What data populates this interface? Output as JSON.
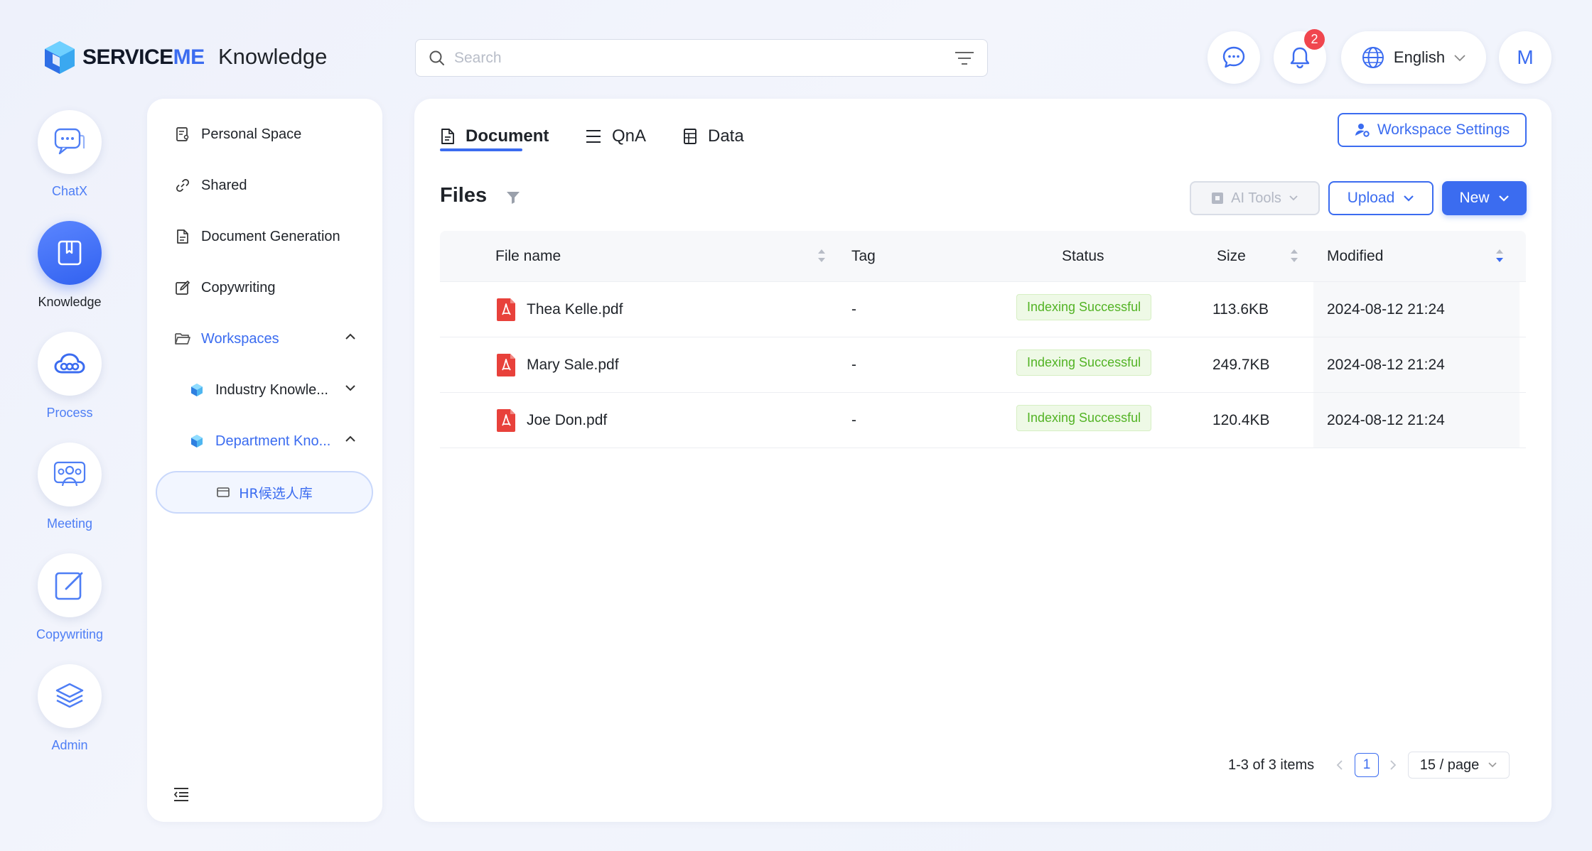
{
  "brand": {
    "logo_text_a": "SERVICE",
    "logo_text_b": "ME",
    "app_title": "Knowledge"
  },
  "search": {
    "placeholder": "Search",
    "value": ""
  },
  "header": {
    "notification_count": "2",
    "language": "English",
    "avatar_initial": "M"
  },
  "rail": [
    {
      "label": "ChatX",
      "icon": "chat-icon"
    },
    {
      "label": "Knowledge",
      "icon": "book-icon",
      "active": true
    },
    {
      "label": "Process",
      "icon": "cloud-process-icon"
    },
    {
      "label": "Meeting",
      "icon": "people-icon"
    },
    {
      "label": "Copywriting",
      "icon": "edit-icon"
    },
    {
      "label": "Admin",
      "icon": "layers-icon"
    }
  ],
  "side_nav": {
    "items": [
      {
        "label": "Personal Space",
        "icon": "personal-doc-icon"
      },
      {
        "label": "Shared",
        "icon": "link-icon"
      },
      {
        "label": "Document Generation",
        "icon": "document-icon"
      },
      {
        "label": "Copywriting",
        "icon": "edit-icon"
      }
    ],
    "workspaces_label": "Workspaces",
    "workspace_children": [
      {
        "label": "Industry Knowle...",
        "expanded": false
      },
      {
        "label": "Department Kno...",
        "expanded": true
      }
    ],
    "selected_folder": "HR候选人库"
  },
  "tabs": [
    {
      "label": "Document",
      "icon": "document-icon",
      "active": true
    },
    {
      "label": "QnA",
      "icon": "list-icon"
    },
    {
      "label": "Data",
      "icon": "data-sheet-icon"
    }
  ],
  "toolbar": {
    "workspace_settings": "Workspace Settings",
    "files_title": "Files",
    "ai_tools": "AI Tools",
    "upload": "Upload",
    "new": "New"
  },
  "table": {
    "columns": [
      "File name",
      "Tag",
      "Status",
      "Size",
      "Modified"
    ],
    "rows": [
      {
        "name": "Thea Kelle.pdf",
        "tag": "-",
        "status": "Indexing Successful",
        "size": "113.6KB",
        "modified": "2024-08-12 21:24"
      },
      {
        "name": "Mary Sale.pdf",
        "tag": "-",
        "status": "Indexing Successful",
        "size": "249.7KB",
        "modified": "2024-08-12 21:24"
      },
      {
        "name": "Joe Don.pdf",
        "tag": "-",
        "status": "Indexing Successful",
        "size": "120.4KB",
        "modified": "2024-08-12 21:24"
      }
    ]
  },
  "pagination": {
    "summary": "1-3 of 3 items",
    "current_page": "1",
    "page_size": "15 / page"
  },
  "colors": {
    "accent": "#3b6cf0",
    "success": "#52b324",
    "badge": "#f0464e",
    "pdf": "#e8413b"
  }
}
